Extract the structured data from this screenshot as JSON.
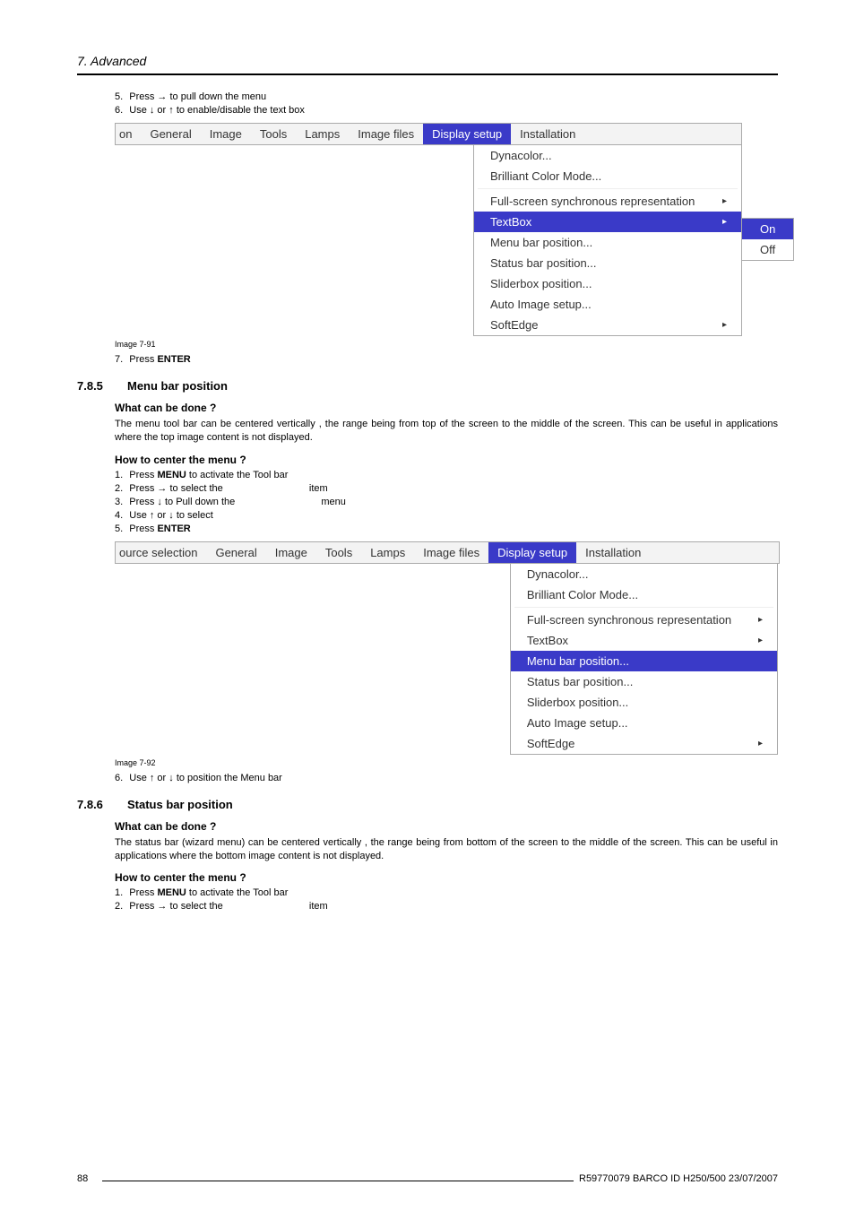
{
  "chapter": "7. Advanced",
  "steps_top": [
    {
      "n": "5.",
      "text": "Press → to pull down the menu"
    },
    {
      "n": "6.",
      "text": "Use ↓ or ↑ to enable/disable the text box"
    }
  ],
  "ui1": {
    "tabs_pre": "on",
    "tabs": [
      "General",
      "Image",
      "Tools",
      "Lamps",
      "Image files"
    ],
    "tab_sel": "Display setup",
    "tab_after": "Installation",
    "dd": [
      {
        "label": "Dynacolor..."
      },
      {
        "label": "Brilliant Color Mode..."
      },
      {
        "sep": true
      },
      {
        "label": "Full-screen synchronous representation",
        "arrow": true
      },
      {
        "label": "TextBox",
        "sel": true,
        "arrow": true
      },
      {
        "label": "Menu bar position..."
      },
      {
        "label": "Status bar position..."
      },
      {
        "label": "Sliderbox position..."
      },
      {
        "label": "Auto Image setup..."
      },
      {
        "label": "SoftEdge",
        "arrow": true
      }
    ],
    "submenu": [
      {
        "label": "On",
        "sel": true
      },
      {
        "label": "Off"
      }
    ]
  },
  "img1_caption": "Image 7-91",
  "step7": {
    "n": "7.",
    "pre": "Press ",
    "bold": "ENTER"
  },
  "sec785": {
    "num": "7.8.5",
    "title": "Menu bar position",
    "h1": "What can be done ?",
    "p1": "The menu tool bar can be centered vertically , the range being from top of the screen to the middle of the screen. This can be useful in applications where the top image content is not displayed.",
    "h2": "How to center the menu ?",
    "steps": [
      {
        "n": "1.",
        "pre": "Press ",
        "bold": "MENU",
        "post": " to activate the Tool bar"
      },
      {
        "n": "2.",
        "pre": "Press → to select the ",
        "post2": "item"
      },
      {
        "n": "3.",
        "pre": "Press ↓ to Pull down the ",
        "post2": "menu"
      },
      {
        "n": "4.",
        "pre": "Use ↑ or ↓ to select"
      },
      {
        "n": "5.",
        "pre": "Press ",
        "bold": "ENTER"
      }
    ]
  },
  "ui2": {
    "tabs_pre": "ource selection",
    "tabs": [
      "General",
      "Image",
      "Tools",
      "Lamps",
      "Image files"
    ],
    "tab_sel": "Display setup",
    "tab_after": "Installation",
    "dd": [
      {
        "label": "Dynacolor..."
      },
      {
        "label": "Brilliant Color Mode..."
      },
      {
        "sep": true
      },
      {
        "label": "Full-screen synchronous representation",
        "arrow": true
      },
      {
        "label": "TextBox",
        "arrow": true
      },
      {
        "label": "Menu bar position...",
        "sel": true
      },
      {
        "label": "Status bar position..."
      },
      {
        "label": "Sliderbox position..."
      },
      {
        "label": "Auto Image setup..."
      },
      {
        "label": "SoftEdge",
        "arrow": true
      }
    ]
  },
  "img2_caption": "Image 7-92",
  "step_after_img2": {
    "n": "6.",
    "text": "Use ↑ or ↓ to position the Menu bar"
  },
  "sec786": {
    "num": "7.8.6",
    "title": "Status bar position",
    "h1": "What can be done ?",
    "p1": "The status bar (wizard menu) can be centered vertically , the range being from bottom of the screen to the middle of the screen. This can be useful in applications where the bottom image content is not displayed.",
    "h2": "How to center the menu ?",
    "steps": [
      {
        "n": "1.",
        "pre": "Press ",
        "bold": "MENU",
        "post": " to activate the Tool bar"
      },
      {
        "n": "2.",
        "pre": "Press → to select the ",
        "post2": "item"
      }
    ]
  },
  "footer": {
    "page": "88",
    "right": "R59770079  BARCO ID H250/500  23/07/2007"
  }
}
